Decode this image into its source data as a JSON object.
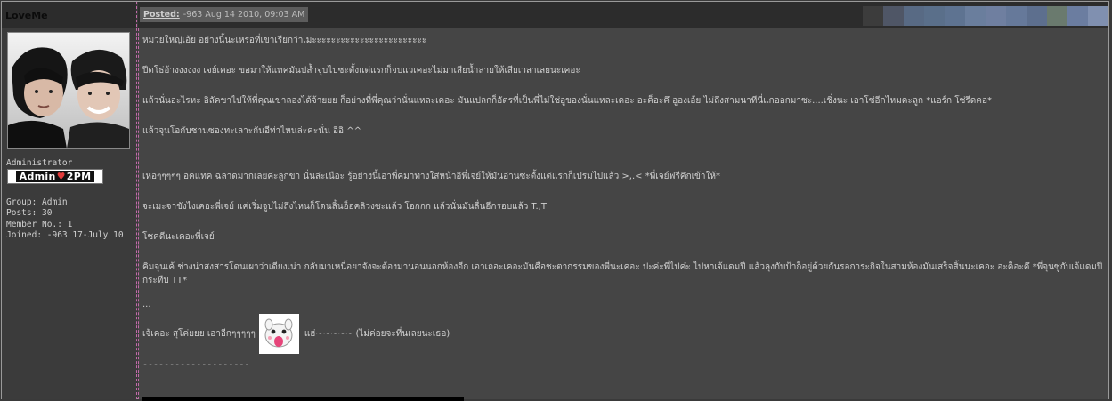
{
  "author": {
    "username": "LoveMe",
    "role": "Administrator",
    "badge": {
      "left": "Admin",
      "heart": "♥",
      "right": "2PM"
    },
    "info": [
      "Group: Admin",
      "Posts: 30",
      "Member No.: 1",
      "Joined: -963 17-July 10"
    ]
  },
  "post": {
    "posted_label": "Posted:",
    "posted_date": "-963 Aug 14 2010, 09:03 AM",
    "swatch_colors": [
      "#3c3c3c",
      "#4f5666",
      "#586a84",
      "#5a6f8a",
      "#5e7391",
      "#6a7e9d",
      "#6f7fa0",
      "#66799a",
      "#5d6f8e",
      "#6a7a6e",
      "#6b7da0",
      "#8090b0"
    ],
    "paragraphs": [
      "หมวยใหญ่เอ้ย อย่างนี้นะเหรอที่เขาเรียกว่าเมะะะะะะะะะะะะะะะะะะะะะะะะ",
      "ปีดโธ่อ้างงงงงง เจย์เคอะ ขอมาให้แทคมันปล้ำจุบไปซะตั้งแต่แรกก็จบแวเคอะไม่มาเสียน้ำลายให้เสียเวลาเลยนะเคอะ",
      "แล้วนั่นอะไรหะ อิลัคขาไปให้พี่คุณเขาลองได้จ้ายยย ก็อย่างที่พี่คุณว่านั่นแหละเคอะ มันแปลกก็อัตรที่เป็นพี่ไม่ใช่อูของนั่นแหละเคอะ อะค็อะคึ อูองเอ้ย ไม่ถึงสามนาทีนี่แกออกมาซะ....เชิ่งนะ เอาโซ่อีกไหมคะลูก *แอร์ก โซ่รีดคอ*",
      "แล้วจุนโอกับชานซองทะเลาะกันอีท่าไหนล่ะคะนั่น อิอิ ^^",
      "เหอๆๆๆๆๆ อคแทค ฉลาดมากเลยค่ะลูกขา นั่นล่ะเนือะ รู้อย่างนี้เอาพี่คมาทางใส่หน้าอิพี่เจย์ให้มันอ่านซะตั้งแต่แรกก็เปรมไปแล้ว >,.< *พี่เจย์ฟรีคิกเข้าให้*",
      "จะเมะจาขังไงเคอะพี่เจย์ แค่เริ่มจูบไม่ถึงไหนก็โดนลิ้นอ็อคลิวงซะแล้ว โอกกก แล้วนั่นมันลื่นอีกรอบแล้ว T.,T",
      "โชคดีนะเคอะพี่เจย์",
      "คิมจุนเค้ ช่างน่าสงสารโดนเผาว่าเดียงเน่า กลับมาเหนื่อยาจังจะต้องมานอนนอกห้องอีก เอาเถอะเคอะมันคือชะตากรรมของพี่นะเคอะ ปะค่ะพี่ไปค่ะ ไปหาเจ้แดมปี แล้วลุงกับป้าก็อยู่ด้วยกันรอการะกิจในสามห้องมันเสร็จสิ้นนะเคอะ อะค็อะคึ *พี่จุนซูกับเจ้แดมปีกระทืบ TT*",
      "...",
      "เจ้เคอะ สุโค่ยยย เอาอีกๆๆๆๆๆ",
      "แฮ่~~~~~ (ไม่ค่อยจะที่นเลยนะเธอ)"
    ],
    "signature_line": "--------------------"
  }
}
